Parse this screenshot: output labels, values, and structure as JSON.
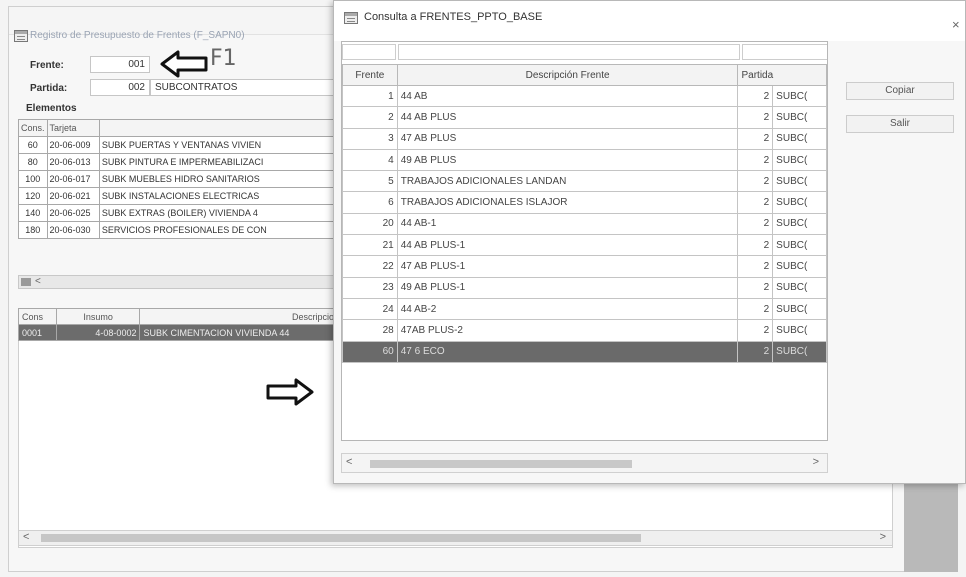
{
  "background_window": {
    "title": "Registro de Presupuesto de Frentes (F_SAPN0)",
    "frente_label": "Frente:",
    "frente_value": "001",
    "partida_label": "Partida:",
    "partida_value": "002",
    "partida_desc": "SUBCONTRATOS",
    "elementos_label": "Elementos",
    "elementos_table": {
      "headers": [
        "Cons.",
        "Tarjeta",
        ""
      ],
      "rows": [
        [
          "60",
          "20-06-009",
          "SUBK PUERTAS Y VENTANAS VIVIEN"
        ],
        [
          "80",
          "20-06-013",
          "SUBK PINTURA E IMPERMEABILIZACI"
        ],
        [
          "100",
          "20-06-017",
          "SUBK MUEBLES HIDRO SANITARIOS"
        ],
        [
          "120",
          "20-06-021",
          "SUBK INSTALACIONES ELECTRICAS"
        ],
        [
          "140",
          "20-06-025",
          "SUBK EXTRAS (BOILER) VIVIENDA 4"
        ],
        [
          "180",
          "20-06-030",
          "SERVICIOS PROFESIONALES DE CON"
        ]
      ]
    },
    "insumos_table": {
      "headers": [
        "Cons",
        "Insumo",
        "Descripcio"
      ],
      "rows": [
        [
          "0001",
          "4-08-0002",
          "SUBK CIMENTACION VIVIENDA 44"
        ]
      ]
    },
    "hscroll_left": "<",
    "bottom_scroll_left": "<",
    "bottom_scroll_right": ">"
  },
  "annotations": {
    "f1_text": "F1"
  },
  "dialog": {
    "title": "Consulta a FRENTES_PPTO_BASE",
    "close_label": "×",
    "columns": [
      "Frente",
      "Descripción Frente",
      "Partida"
    ],
    "rows": [
      {
        "frente": "1",
        "desc": "44 AB",
        "partida": "2",
        "subc": "SUBC("
      },
      {
        "frente": "2",
        "desc": "44 AB PLUS",
        "partida": "2",
        "subc": "SUBC("
      },
      {
        "frente": "3",
        "desc": "47 AB PLUS",
        "partida": "2",
        "subc": "SUBC("
      },
      {
        "frente": "4",
        "desc": "49 AB PLUS",
        "partida": "2",
        "subc": "SUBC("
      },
      {
        "frente": "5",
        "desc": "TRABAJOS ADICIONALES LANDAN",
        "partida": "2",
        "subc": "SUBC("
      },
      {
        "frente": "6",
        "desc": "TRABAJOS ADICIONALES ISLAJOR",
        "partida": "2",
        "subc": "SUBC("
      },
      {
        "frente": "20",
        "desc": "44 AB-1",
        "partida": "2",
        "subc": "SUBC("
      },
      {
        "frente": "21",
        "desc": "44 AB PLUS-1",
        "partida": "2",
        "subc": "SUBC("
      },
      {
        "frente": "22",
        "desc": "47 AB PLUS-1",
        "partida": "2",
        "subc": "SUBC("
      },
      {
        "frente": "23",
        "desc": "49 AB PLUS-1",
        "partida": "2",
        "subc": "SUBC("
      },
      {
        "frente": "24",
        "desc": "44 AB-2",
        "partida": "2",
        "subc": "SUBC("
      },
      {
        "frente": "28",
        "desc": "47AB PLUS-2",
        "partida": "2",
        "subc": "SUBC("
      },
      {
        "frente": "60",
        "desc": "47 6 ECO",
        "partida": "2",
        "subc": "SUBC("
      }
    ],
    "selected_row": 12,
    "copy_button": "Copiar",
    "exit_button": "Salir",
    "hscroll_left": "<",
    "hscroll_right": ">"
  }
}
